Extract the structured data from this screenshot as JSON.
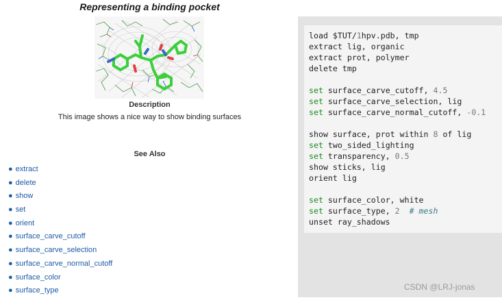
{
  "title": "Representing a binding pocket",
  "description": {
    "heading": "Description",
    "text": "This image shows a nice way to show binding surfaces"
  },
  "see_also": {
    "heading": "See Also",
    "links": [
      "extract",
      "delete",
      "show",
      "set",
      "orient",
      "surface_carve_cutoff",
      "surface_carve_selection",
      "surface_carve_normal_cutoff",
      "surface_color",
      "surface_type"
    ]
  },
  "code": {
    "l1a": "load $TUT/",
    "l1b": "1",
    "l1c": "hpv.pdb, tmp",
    "l2": "extract lig, organic",
    "l3": "extract prot, polymer",
    "l4": "delete tmp",
    "l6kw": "set",
    "l6a": " surface_carve_cutoff, ",
    "l6n": "4.5",
    "l7kw": "set",
    "l7a": " surface_carve_selection, lig",
    "l8kw": "set",
    "l8a": " surface_carve_normal_cutoff, ",
    "l8n": "-0.1",
    "l10a": "show surface, prot within ",
    "l10n": "8",
    "l10b": " of lig",
    "l11kw": "set",
    "l11a": " two_sided_lighting",
    "l12kw": "set",
    "l12a": " transparency, ",
    "l12n": "0.5",
    "l13": "show sticks, lig",
    "l14": "orient lig",
    "l16kw": "set",
    "l16a": " surface_color, white",
    "l17kw": "set",
    "l17a": " surface_type, ",
    "l17n": "2",
    "l17c": "  # mesh",
    "l18": "unset ray_shadows"
  },
  "watermark": "CSDN @LRJ-jonas",
  "colors": {
    "link": "#1f5aa6",
    "keyword": "#1a8a1a",
    "stick": "#3ccf3c"
  }
}
